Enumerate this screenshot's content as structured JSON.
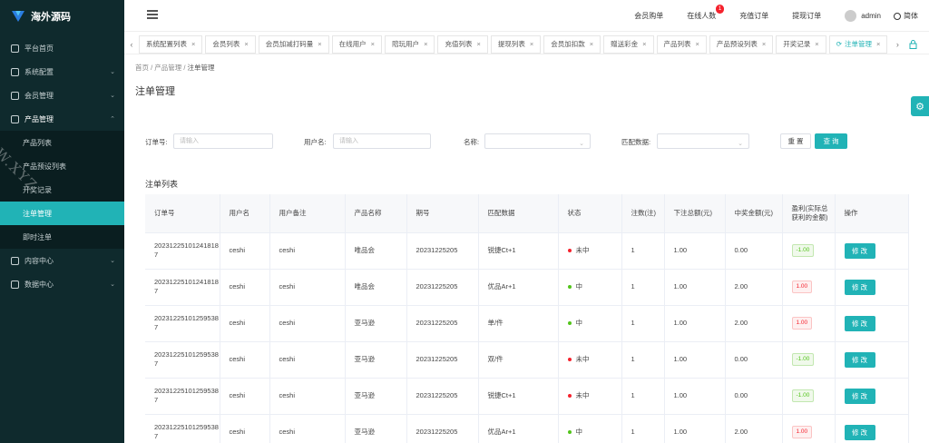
{
  "brand": {
    "name": "海外源码",
    "accent": "#21b3b6",
    "sidebar_bg": "#0f2a2d"
  },
  "sidebar": {
    "items": [
      {
        "label": "平台首页",
        "icon": "home-icon",
        "has_children": false
      },
      {
        "label": "系统配置",
        "icon": "edit-icon",
        "has_children": true
      },
      {
        "label": "会员管理",
        "icon": "grid-icon",
        "has_children": true
      },
      {
        "label": "产品管理",
        "icon": "box-icon",
        "has_children": true,
        "open": true
      },
      {
        "label": "内容中心",
        "icon": "doc-icon",
        "has_children": true
      },
      {
        "label": "数据中心",
        "icon": "chart-icon",
        "has_children": true
      }
    ],
    "sub_items": [
      {
        "label": "产品列表",
        "active": false
      },
      {
        "label": "产品预设列表",
        "active": false
      },
      {
        "label": "开奖记录",
        "active": false
      },
      {
        "label": "注单管理",
        "active": true
      },
      {
        "label": "即时注单",
        "active": false
      }
    ],
    "watermark": "DW.XYZ"
  },
  "header": {
    "nav": [
      "会员购单",
      "在线人数",
      "充值订单",
      "提现订单"
    ],
    "online_badge": "1",
    "user": "admin",
    "lang": "简体"
  },
  "tabs": [
    {
      "label": "系统配置列表"
    },
    {
      "label": "会员列表"
    },
    {
      "label": "会员加减打码量"
    },
    {
      "label": "在线用户"
    },
    {
      "label": "陪玩用户"
    },
    {
      "label": "充值列表"
    },
    {
      "label": "提现列表"
    },
    {
      "label": "会员加扣款"
    },
    {
      "label": "赠送彩金"
    },
    {
      "label": "产品列表"
    },
    {
      "label": "产品预设列表"
    },
    {
      "label": "开奖记录"
    },
    {
      "label": "注单管理",
      "active": true
    }
  ],
  "breadcrumb": [
    "首页",
    "产品管理",
    "注单管理"
  ],
  "page_title": "注单管理",
  "filter": {
    "order_label": "订单号:",
    "order_placeholder": "请输入",
    "user_label": "用户名:",
    "user_placeholder": "请输入",
    "name_label": "名称:",
    "match_label": "匹配数据:",
    "reset": "重 置",
    "search": "查 询"
  },
  "section_title": "注单列表",
  "table": {
    "headers": [
      "订单号",
      "用户名",
      "用户备注",
      "产品名称",
      "期号",
      "匹配数据",
      "状态",
      "注数(注)",
      "下注总额(元)",
      "中奖金额(元)",
      "盈利(实际总获利的金额)",
      "操作"
    ],
    "rows": [
      {
        "order": "202312251012418187",
        "user": "ceshi",
        "remark": "ceshi",
        "product": "唯品会",
        "period": "20231225205",
        "match": "锐捷Ct+1",
        "status": "未中",
        "status_color": "#f5222d",
        "count": "1",
        "bet": "1.00",
        "win": "0.00",
        "profit": "-1.00",
        "profit_type": "pos",
        "action": "修 改"
      },
      {
        "order": "202312251012418187",
        "user": "ceshi",
        "remark": "ceshi",
        "product": "唯品会",
        "period": "20231225205",
        "match": "优品Ar+1",
        "status": "中",
        "status_color": "#52c41a",
        "count": "1",
        "bet": "1.00",
        "win": "2.00",
        "profit": "1.00",
        "profit_type": "neg",
        "action": "修 改"
      },
      {
        "order": "202312251012595387",
        "user": "ceshi",
        "remark": "ceshi",
        "product": "亚马逊",
        "period": "20231225205",
        "match": "单/件",
        "status": "中",
        "status_color": "#52c41a",
        "count": "1",
        "bet": "1.00",
        "win": "2.00",
        "profit": "1.00",
        "profit_type": "neg",
        "action": "修 改"
      },
      {
        "order": "202312251012595387",
        "user": "ceshi",
        "remark": "ceshi",
        "product": "亚马逊",
        "period": "20231225205",
        "match": "双/件",
        "status": "未中",
        "status_color": "#f5222d",
        "count": "1",
        "bet": "1.00",
        "win": "0.00",
        "profit": "-1.00",
        "profit_type": "pos",
        "action": "修 改"
      },
      {
        "order": "202312251012595387",
        "user": "ceshi",
        "remark": "ceshi",
        "product": "亚马逊",
        "period": "20231225205",
        "match": "锐捷Ct+1",
        "status": "未中",
        "status_color": "#f5222d",
        "count": "1",
        "bet": "1.00",
        "win": "0.00",
        "profit": "-1.00",
        "profit_type": "pos",
        "action": "修 改"
      },
      {
        "order": "202312251012595387",
        "user": "ceshi",
        "remark": "ceshi",
        "product": "亚马逊",
        "period": "20231225205",
        "match": "优品Ar+1",
        "status": "中",
        "status_color": "#52c41a",
        "count": "1",
        "bet": "1.00",
        "win": "2.00",
        "profit": "1.00",
        "profit_type": "neg",
        "action": "修 改"
      }
    ]
  }
}
